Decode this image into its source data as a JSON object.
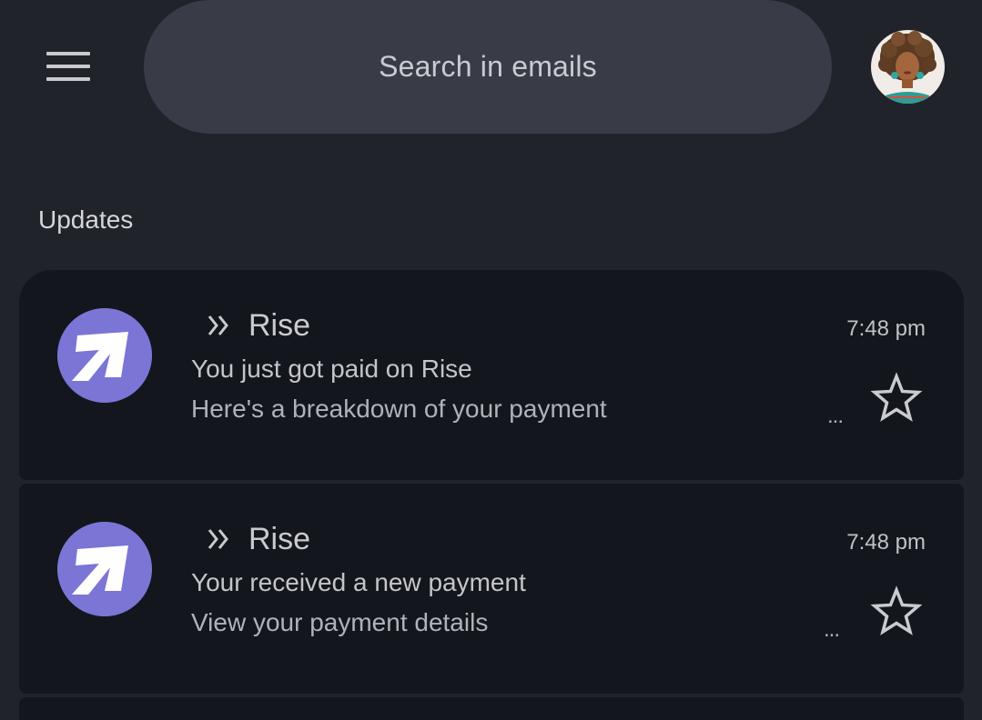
{
  "search": {
    "placeholder": "Search in emails"
  },
  "section": {
    "title": "Updates"
  },
  "emails": [
    {
      "sender": "Rise",
      "time": "7:48 pm",
      "subject": "You just got paid on Rise",
      "snippet": "Here's a breakdown of your payment",
      "more": "...",
      "starred": false
    },
    {
      "sender": "Rise",
      "time": "7:48 pm",
      "subject": "Your received a new payment",
      "snippet": "View your payment details",
      "more": "...",
      "starred": false
    }
  ],
  "colors": {
    "background": "#21232b",
    "card": "#14161d",
    "search_bg": "#393c46",
    "rise_brand": "#7b75d6"
  },
  "icons": {
    "menu": "hamburger-menu-icon",
    "importance": "double-chevron-right-icon",
    "star": "star-outline-icon",
    "sender_logo": "rise-logo"
  }
}
